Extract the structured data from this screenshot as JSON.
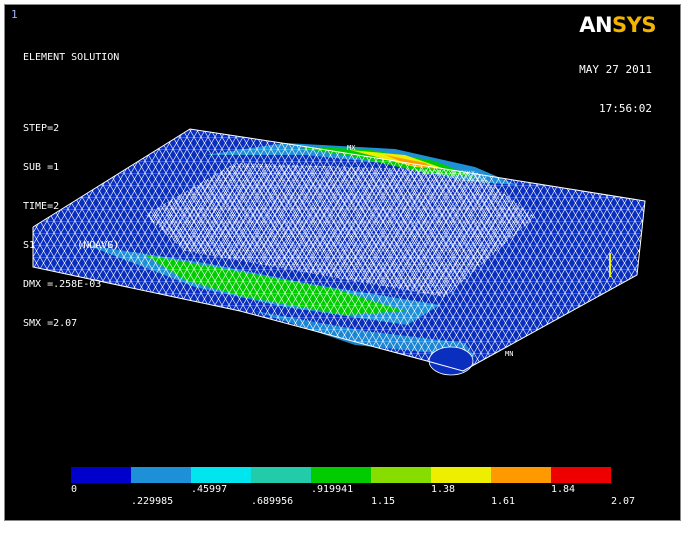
{
  "window": {
    "number": "1",
    "logo_an": "AN",
    "logo_sys": "SYS"
  },
  "info": {
    "title": "ELEMENT SOLUTION",
    "step": "STEP=2",
    "sub": "SUB =1",
    "time": "TIME=2",
    "s1": "S1       (NOAVG)",
    "dmx": "DMX =.258E-03",
    "smx": "SMX =2.07"
  },
  "date": {
    "date": "MAY 27 2011",
    "time": "17:56:02"
  },
  "markers": {
    "mx": "MX",
    "mn": "MN"
  },
  "legend": {
    "colors": [
      "#0000cc",
      "#1e90d8",
      "#00e5ee",
      "#22ccaa",
      "#00cc00",
      "#88dd00",
      "#eeee00",
      "#ff9900",
      "#ee0000"
    ],
    "top_labels": [
      "0",
      ".45997",
      ".919941",
      "1.38",
      "1.84"
    ],
    "bottom_labels": [
      ".229985",
      ".689956",
      "1.15",
      "1.61",
      "2.07"
    ]
  }
}
